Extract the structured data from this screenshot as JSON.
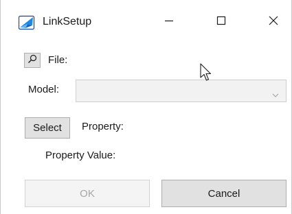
{
  "window": {
    "title": "LinkSetup",
    "icon": "linksetup-app-icon",
    "controls": [
      "minimize-icon",
      "maximize-icon",
      "close-icon"
    ]
  },
  "form": {
    "file_label": "File:",
    "file_button_icon": "search-icon",
    "model_label": "Model:",
    "model_value": "",
    "select_button_label": "Select",
    "property_label": "Property:",
    "property_value_label": "Property Value:"
  },
  "footer": {
    "ok_label": "OK",
    "cancel_label": "Cancel"
  },
  "colors": {
    "icon_blue": "#1e88e5",
    "button_face": "#e1e1e1",
    "disabled_text": "#a6a6a6"
  }
}
